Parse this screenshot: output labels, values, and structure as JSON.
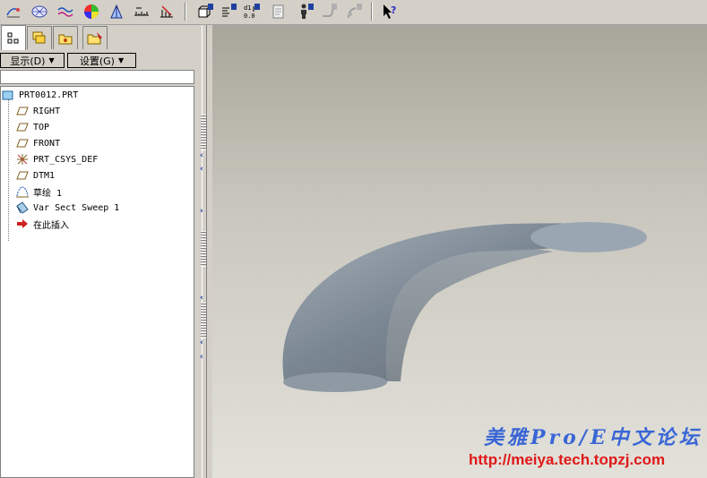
{
  "toolbar": {
    "icons": [
      "sketch-tool-icon",
      "curvature-icon",
      "curve-wave-icon",
      "color-sphere-icon",
      "section-icon",
      "measure-icon",
      "analysis-icon",
      "view-1-icon",
      "view-2-icon",
      "view-3-icon",
      "view-4-icon",
      "view-5-icon",
      "view-6-icon",
      "view-7-icon",
      "help-cursor-icon"
    ]
  },
  "panel": {
    "display_menu": "显示(D)",
    "settings_menu": "设置(G)"
  },
  "tree": {
    "items": [
      {
        "label": "PRT0012.PRT",
        "icon": "part-icon"
      },
      {
        "label": "RIGHT",
        "icon": "datum-plane-icon"
      },
      {
        "label": "TOP",
        "icon": "datum-plane-icon"
      },
      {
        "label": "FRONT",
        "icon": "datum-plane-icon"
      },
      {
        "label": "PRT_CSYS_DEF",
        "icon": "csys-icon"
      },
      {
        "label": "DTM1",
        "icon": "datum-plane-icon"
      },
      {
        "label": "草绘 1",
        "icon": "sketch-icon"
      },
      {
        "label": "Var Sect Sweep 1",
        "icon": "sweep-icon"
      },
      {
        "label": "在此插入",
        "icon": "insert-arrow-icon"
      }
    ]
  },
  "viewport": {
    "watermark_title": "美雅Pro/E中文论坛",
    "watermark_url": "http://meiya.tech.topzj.com"
  },
  "colors": {
    "surface": "#8a96a2",
    "watermark_blue": "#3a66d6",
    "watermark_red": "#e01818"
  }
}
